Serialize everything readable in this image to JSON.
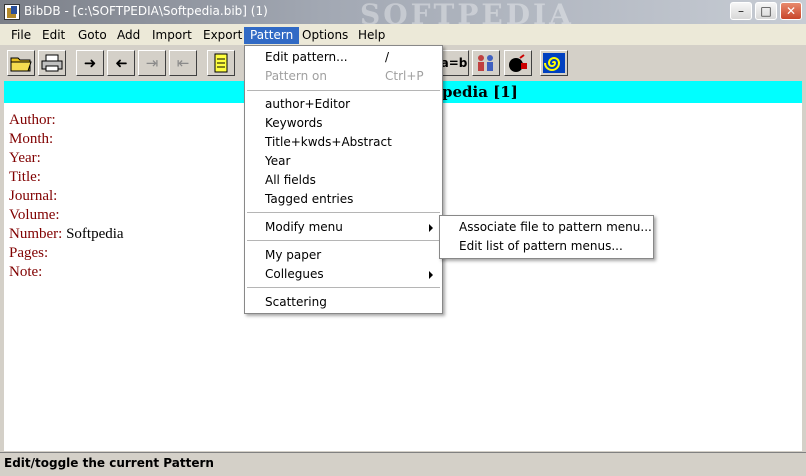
{
  "window": {
    "title": "BibDB - [c:\\SOFTPEDIA\\Softpedia.bib] (1)",
    "watermark": "SOFTPEDIA",
    "controls": {
      "minimize": "–",
      "maximize": "□",
      "close": "✕"
    }
  },
  "menubar": [
    "File",
    "Edit",
    "Goto",
    "Add",
    "Import",
    "Export",
    "Pattern",
    "Options",
    "Help"
  ],
  "toolbar": {
    "equals_label": "a=b"
  },
  "header_band": {
    "text": "pedia  [1]"
  },
  "record": {
    "fields": [
      {
        "label": "Author:",
        "value": ""
      },
      {
        "label": "Month:",
        "value": ""
      },
      {
        "label": "Year:",
        "value": ""
      },
      {
        "label": "Title:",
        "value": ""
      },
      {
        "label": "Journal:",
        "value": ""
      },
      {
        "label": "Volume:",
        "value": ""
      },
      {
        "label": "Number:",
        "value": "Softpedia"
      },
      {
        "label": "Pages:",
        "value": ""
      },
      {
        "label": "Note:",
        "value": ""
      }
    ]
  },
  "pattern_menu": {
    "edit_pattern": {
      "label": "Edit pattern...",
      "shortcut": "/"
    },
    "pattern_on": {
      "label": "Pattern on",
      "shortcut": "Ctrl+P"
    },
    "author_editor": "author+Editor",
    "keywords": "Keywords",
    "title_kwds_abstract": "Title+kwds+Abstract",
    "year": "Year",
    "all_fields": "All fields",
    "tagged_entries": "Tagged entries",
    "modify_menu": "Modify menu",
    "my_paper": "My paper",
    "collegues": "Collegues",
    "scattering": "Scattering"
  },
  "modify_submenu": {
    "associate": "Associate file to pattern menu...",
    "edit_list": "Edit list of pattern menus..."
  },
  "statusbar": {
    "text": "Edit/toggle the current Pattern"
  }
}
